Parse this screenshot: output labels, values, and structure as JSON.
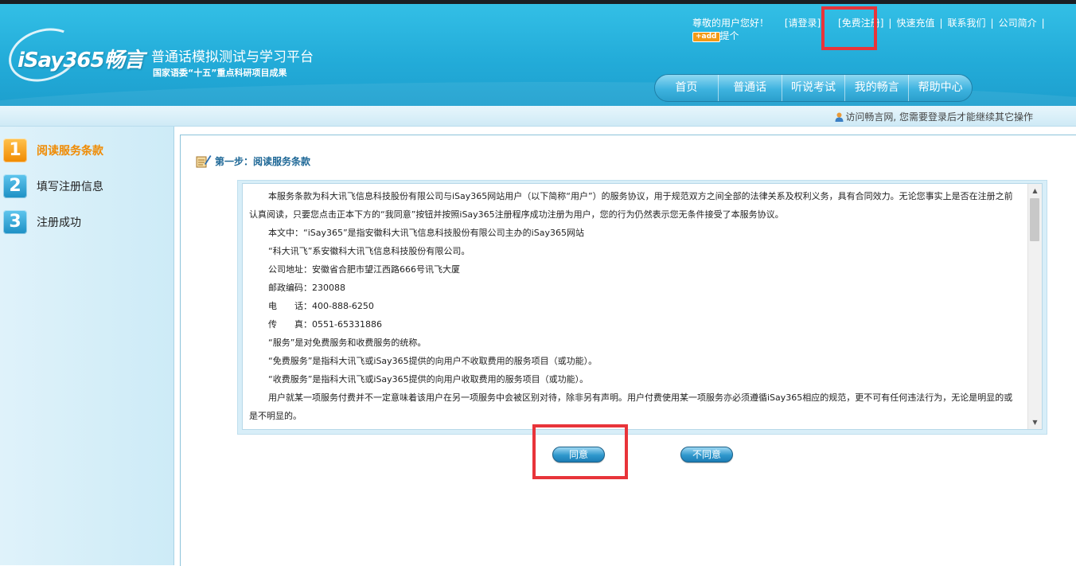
{
  "header": {
    "logo_text": "iSay365畅言",
    "slogan_main": "普通话模拟测试与学习平台",
    "slogan_sub": "国家语委“十五”重点科研项目成果",
    "greeting": "尊敬的用户您好！",
    "login_link": "[请登录]",
    "register_link": "[免费注册]",
    "links": [
      "快速充值",
      "联系我们",
      "公司简介"
    ],
    "add_badge": "+add",
    "add_label": "提个"
  },
  "nav": {
    "items": [
      "首页",
      "普通话",
      "听说考试",
      "我的畅言",
      "帮助中心"
    ]
  },
  "subbar": {
    "login_tip": "访问畅言网, 您需要登录后才能继续其它操作"
  },
  "steps": [
    {
      "num": "1",
      "label": "阅读服务条款",
      "active": true
    },
    {
      "num": "2",
      "label": "填写注册信息",
      "active": false
    },
    {
      "num": "3",
      "label": "注册成功",
      "active": false
    }
  ],
  "main": {
    "step_title": "第一步：阅读服务条款",
    "terms": [
      "本服务条款为科大讯飞信息科技股份有限公司与iSay365网站用户（以下简称“用户”）的服务协议，用于规范双方之间全部的法律关系及权利义务，具有合同效力。无论您事实上是否在注册之前认真阅读，只要您点击正本下方的“我同意”按钮并按照iSay365注册程序成功注册为用户，您的行为仍然表示您无条件接受了本服务协议。",
      "本文中：“iSay365”是指安徽科大讯飞信息科技股份有限公司主办的iSay365网站",
      "“科大讯飞”系安徽科大讯飞信息科技股份有限公司。",
      "公司地址：安徽省合肥市望江西路666号讯飞大厦",
      "邮政编码：230088",
      "电　　话：400-888-6250",
      "传　　真：0551-65331886",
      "“服务”是对免费服务和收费服务的统称。",
      "“免费服务”是指科大讯飞或iSay365提供的向用户不收取费用的服务项目（或功能）。",
      "“收费服务”是指科大讯飞或iSay365提供的向用户收取费用的服务项目（或功能）。",
      "用户就某一项服务付费并不一定意味着该用户在另一项服务中会被区别对待，除非另有声明。用户付费使用某一项服务亦必须遵循iSay365相应的规范，更不可有任何违法行为，无论是明显的或是不明显的。"
    ],
    "agree_label": "同意",
    "disagree_label": "不同意"
  }
}
